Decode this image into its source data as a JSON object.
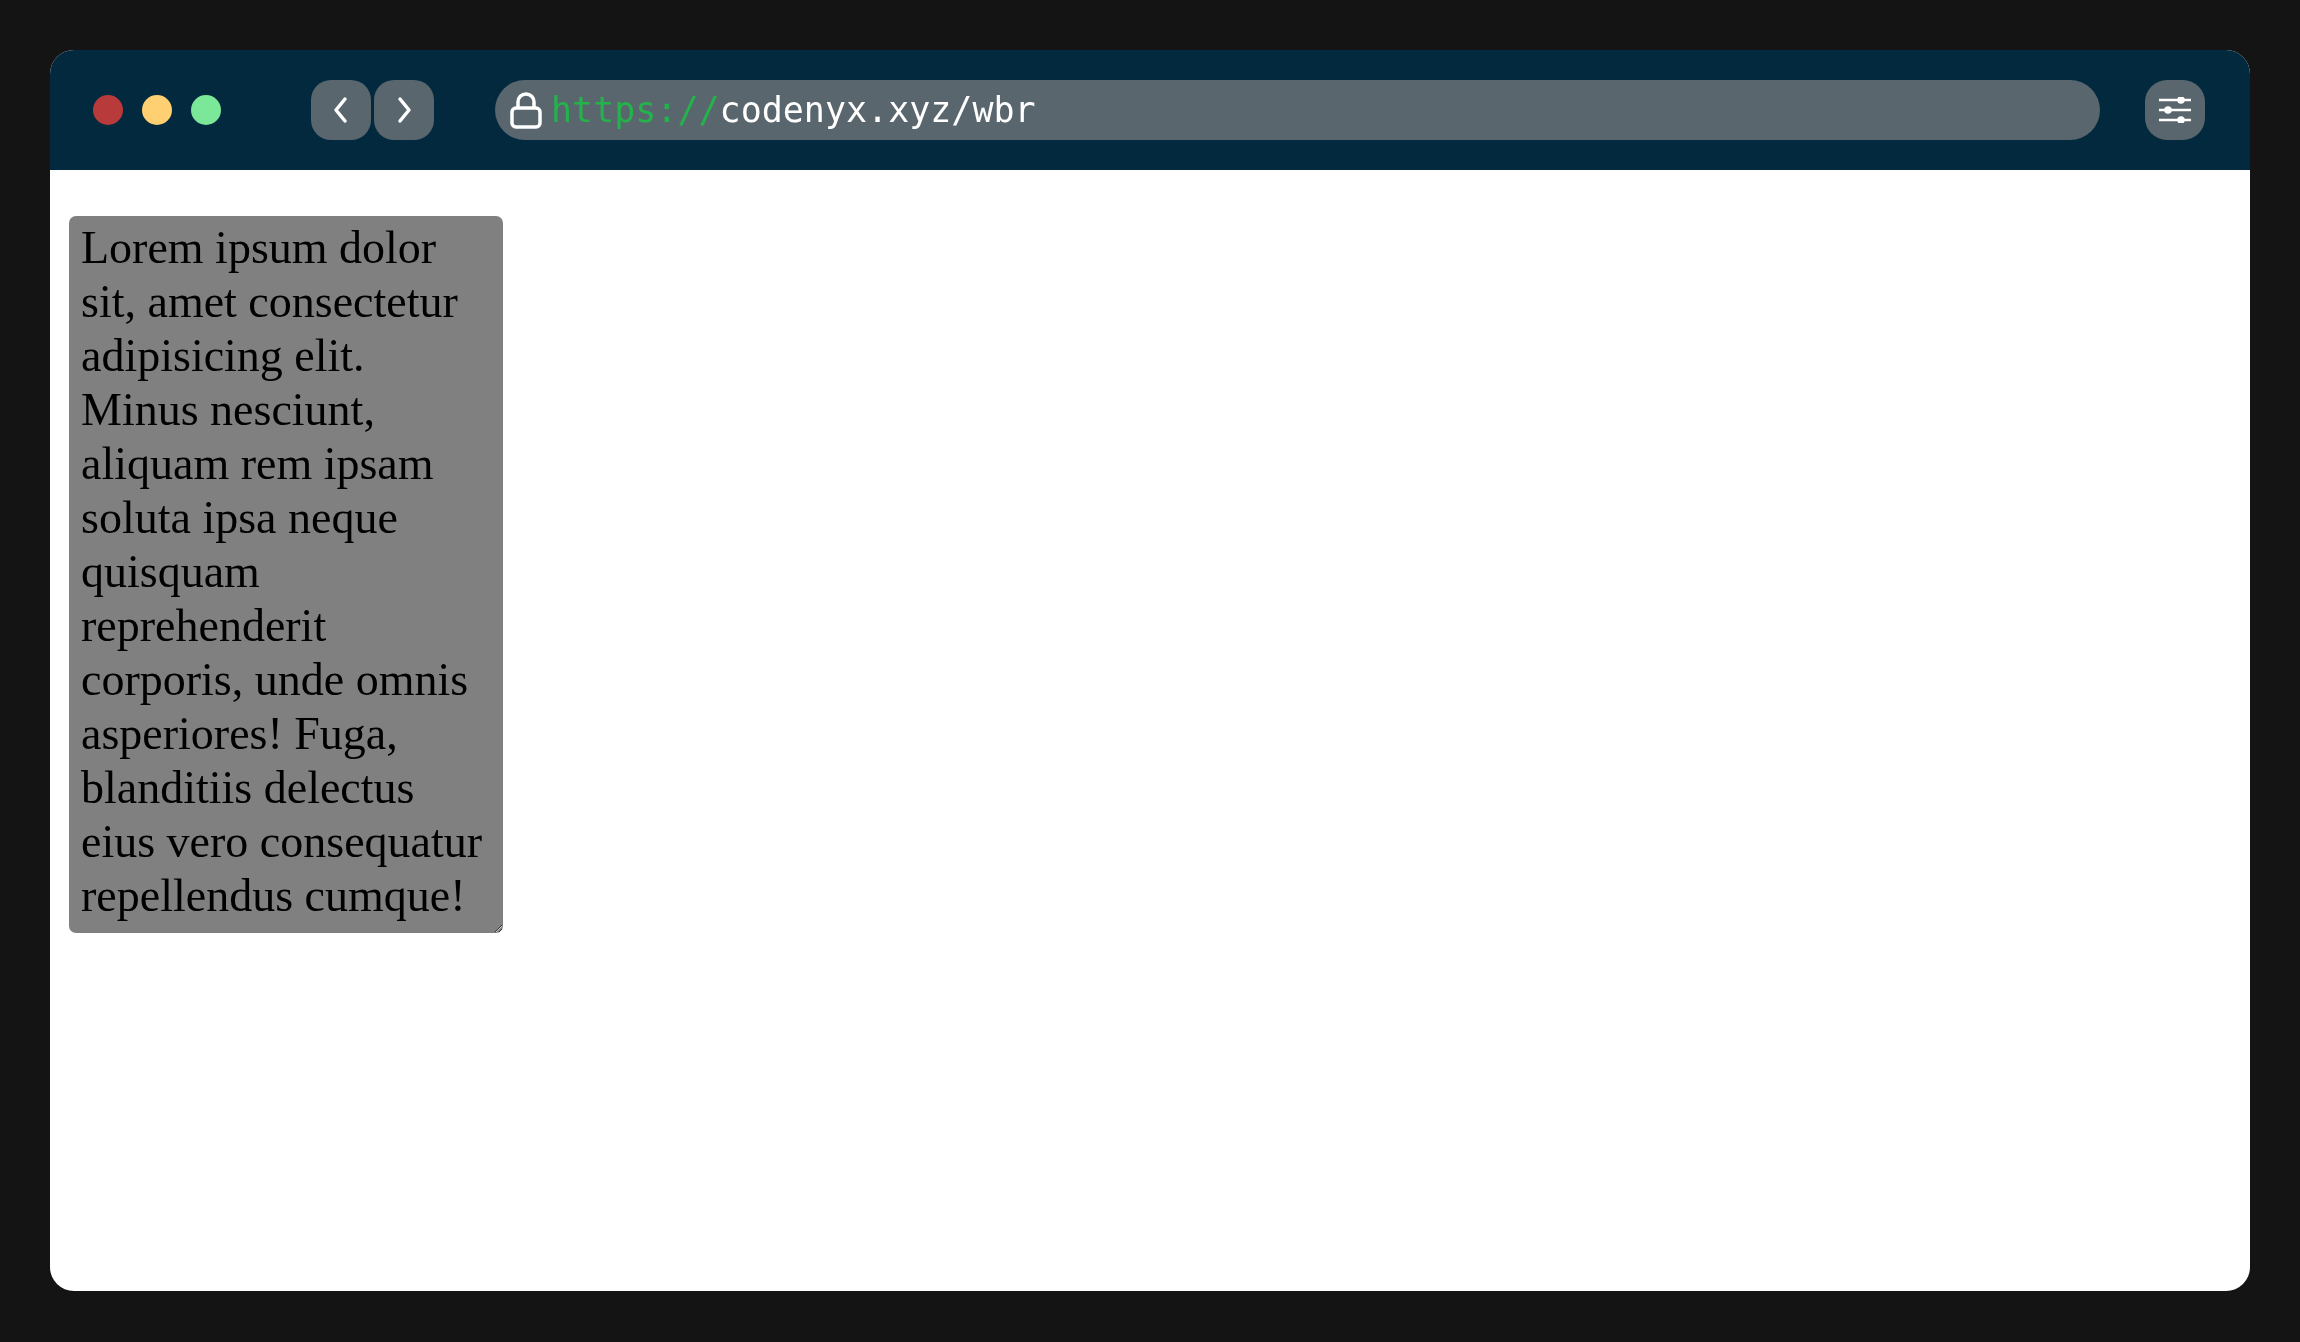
{
  "browser": {
    "window_controls": [
      {
        "color": "#b83a3a"
      },
      {
        "color": "#ffd071"
      },
      {
        "color": "#7ae898"
      }
    ],
    "address_bar": {
      "scheme": "https://",
      "address": "codenyx.xyz/wbr"
    }
  },
  "content": {
    "text_block": "Lorem ipsum dolor sit, amet consectetur adipisicing elit. Minus nesciunt, aliquam rem ipsam soluta ipsa neque quisquam reprehenderit corporis, unde omnis asperiores! Fuga, blanditiis delectus eius vero consequatur repellendus cumque!"
  }
}
